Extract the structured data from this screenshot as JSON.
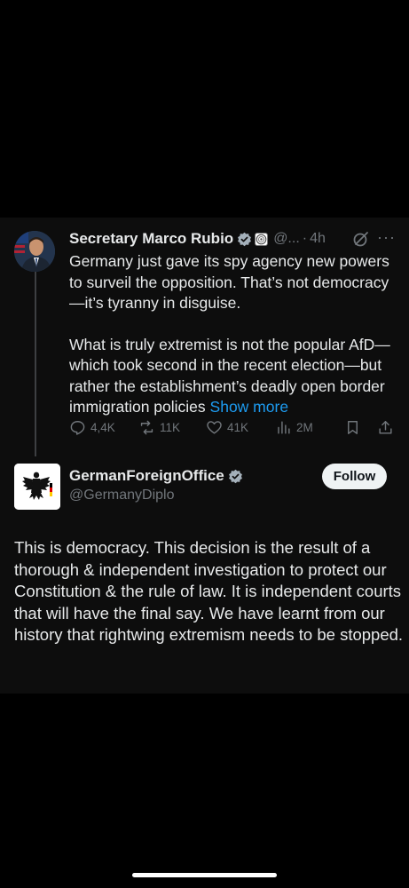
{
  "tweet": {
    "author_name": "Secretary Marco Rubio",
    "handle": "@...",
    "separator": "·",
    "time": "4h",
    "more_icon": "···",
    "paragraphs": [
      "Germany just gave its spy agency new powers to surveil the opposition.  That’s not democracy—it’s tyranny in disguise.",
      "What is truly extremist is not the popular AfD—which took second in the recent election—but rather the establishment’s deadly open border immigration policies"
    ],
    "show_more": "Show more",
    "stats": {
      "replies": "4,4K",
      "reposts": "11K",
      "likes": "41K",
      "views": "2M"
    }
  },
  "reply": {
    "author_name": "GermanForeignOffice",
    "handle": "@GermanyDiplo",
    "follow_label": "Follow",
    "text": "This is democracy. This decision is the result of a thorough & independent investigation to protect our Constitution & the rule of law. It is independent courts that will have the final say. We have learnt from our history that rightwing extremism needs to be stopped."
  },
  "colors": {
    "background": "#000000",
    "card": "#0d0d0d",
    "text": "#e7e9ea",
    "muted": "#71767b",
    "link": "#1d9bf0",
    "verified": "#a4b0ba"
  },
  "icons": [
    "verified-badge-icon",
    "government-badge-icon",
    "grok-icon",
    "more-icon",
    "reply-icon",
    "repost-icon",
    "like-icon",
    "views-icon",
    "bookmark-icon",
    "share-icon"
  ]
}
